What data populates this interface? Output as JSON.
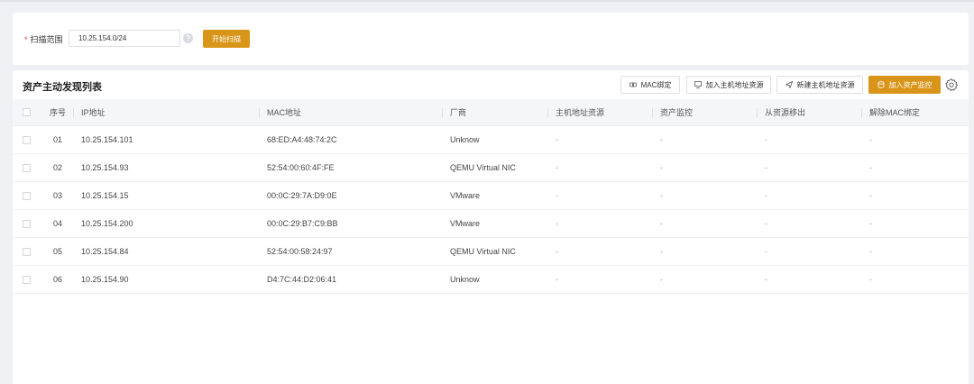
{
  "scan": {
    "label": "扫描范围",
    "required_mark": "*",
    "value": "10.25.154.0/24",
    "help_icon": "question-icon",
    "start_button": "开始扫描"
  },
  "list": {
    "title": "资产主动发现列表",
    "toolbar": [
      {
        "label": "MAC绑定",
        "icon": "link-icon"
      },
      {
        "label": "加入主机地址资源",
        "icon": "host-icon"
      },
      {
        "label": "新建主机地址资源",
        "icon": "send-icon"
      },
      {
        "label": "加入资产监控",
        "icon": "database-icon"
      }
    ],
    "settings_icon": "gear-icon",
    "columns": [
      "序号",
      "IP地址",
      "MAC地址",
      "厂商",
      "主机地址资源",
      "资产监控",
      "从资源移出",
      "解除MAC绑定"
    ],
    "rows": [
      {
        "no": "01",
        "ip": "10.25.154.101",
        "mac": "68:ED:A4:48:74:2C",
        "vendor": "Unknow",
        "host": "-",
        "monitor": "-",
        "remove": "-",
        "unbind": "-"
      },
      {
        "no": "02",
        "ip": "10.25.154.93",
        "mac": "52:54:00:60:4F:FE",
        "vendor": "QEMU Virtual NIC",
        "host": "-",
        "monitor": "-",
        "remove": "-",
        "unbind": "-"
      },
      {
        "no": "03",
        "ip": "10.25.154.15",
        "mac": "00:0C:29:7A:D9:0E",
        "vendor": "VMware",
        "host": "-",
        "monitor": "-",
        "remove": "-",
        "unbind": "-"
      },
      {
        "no": "04",
        "ip": "10.25.154.200",
        "mac": "00:0C:29:B7:C9:BB",
        "vendor": "VMware",
        "host": "-",
        "monitor": "-",
        "remove": "-",
        "unbind": "-"
      },
      {
        "no": "05",
        "ip": "10.25.154.84",
        "mac": "52:54:00:58:24:97",
        "vendor": "QEMU Virtual NIC",
        "host": "-",
        "monitor": "-",
        "remove": "-",
        "unbind": "-"
      },
      {
        "no": "06",
        "ip": "10.25.154.90",
        "mac": "D4:7C:44:D2:06:41",
        "vendor": "Unknow",
        "host": "-",
        "monitor": "-",
        "remove": "-",
        "unbind": "-"
      }
    ]
  },
  "colors": {
    "accent": "#d99519",
    "required": "#e23a3a",
    "background": "#eef0f3"
  }
}
